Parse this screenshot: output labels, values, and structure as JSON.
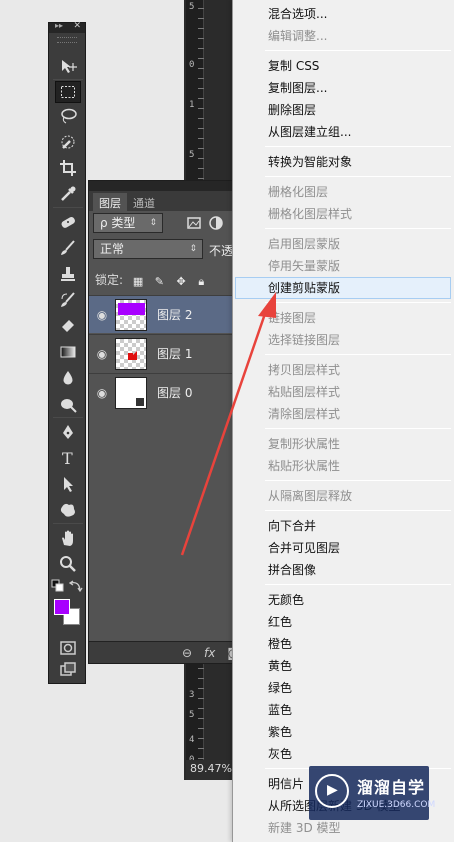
{
  "ruler": {
    "labels": [
      "5",
      "0",
      "1",
      "5",
      "5",
      "0",
      "3",
      "0",
      "3",
      "5",
      "4",
      "0"
    ]
  },
  "zoom": "89.47%",
  "tools": {
    "items": [
      {
        "name": "move-tool",
        "icon": "move-icon"
      },
      {
        "name": "marquee-tool",
        "icon": "marquee-icon"
      },
      {
        "name": "lasso-tool",
        "icon": "lasso-icon"
      },
      {
        "name": "quick-select-tool",
        "icon": "quick-select-icon"
      },
      {
        "name": "crop-tool",
        "icon": "crop-icon"
      },
      {
        "name": "eyedropper-tool",
        "icon": "eyedropper-icon"
      },
      {
        "name": "healing-tool",
        "icon": "bandage-icon"
      },
      {
        "name": "brush-tool",
        "icon": "brush-icon"
      },
      {
        "name": "stamp-tool",
        "icon": "stamp-icon"
      },
      {
        "name": "history-brush-tool",
        "icon": "history-brush-icon"
      },
      {
        "name": "eraser-tool",
        "icon": "eraser-icon"
      },
      {
        "name": "gradient-tool",
        "icon": "gradient-icon"
      },
      {
        "name": "blur-tool",
        "icon": "drop-icon"
      },
      {
        "name": "dodge-tool",
        "icon": "dodge-icon"
      },
      {
        "name": "pen-tool",
        "icon": "pen-icon"
      },
      {
        "name": "type-tool",
        "icon": "type-icon"
      },
      {
        "name": "path-select-tool",
        "icon": "arrow-icon"
      },
      {
        "name": "shape-tool",
        "icon": "shape-icon"
      },
      {
        "name": "hand-tool",
        "icon": "hand-icon"
      },
      {
        "name": "zoom-tool",
        "icon": "magnifier-icon"
      }
    ],
    "foreground_color": "#a800ff",
    "background_color": "#ffffff"
  },
  "layers_panel": {
    "tabs": [
      "图层",
      "通道"
    ],
    "filter_label": "ρ 类型",
    "blend_mode": "正常",
    "opacity_label": "不透",
    "lock_label": "锁定:",
    "layers": [
      {
        "name": "图层 2",
        "selected": true
      },
      {
        "name": "图层 1",
        "selected": false
      },
      {
        "name": "图层 0",
        "selected": false
      }
    ],
    "bottom_icons": [
      "link-icon",
      "fx-icon",
      "mask-icon"
    ],
    "fx_label": "fx"
  },
  "menu": {
    "items": [
      {
        "label": "混合选项...",
        "enabled": true
      },
      {
        "label": "编辑调整...",
        "enabled": false
      },
      {
        "sep": true
      },
      {
        "label": "复制 CSS",
        "enabled": true
      },
      {
        "label": "复制图层...",
        "enabled": true
      },
      {
        "label": "删除图层",
        "enabled": true
      },
      {
        "label": "从图层建立组...",
        "enabled": true
      },
      {
        "sep": true
      },
      {
        "label": "转换为智能对象",
        "enabled": true
      },
      {
        "sep": true
      },
      {
        "label": "栅格化图层",
        "enabled": false
      },
      {
        "label": "栅格化图层样式",
        "enabled": false
      },
      {
        "sep": true
      },
      {
        "label": "启用图层蒙版",
        "enabled": false
      },
      {
        "label": "停用矢量蒙版",
        "enabled": false
      },
      {
        "label": "创建剪贴蒙版",
        "enabled": true,
        "highlighted": true
      },
      {
        "sep": true
      },
      {
        "label": "链接图层",
        "enabled": false
      },
      {
        "label": "选择链接图层",
        "enabled": false
      },
      {
        "sep": true
      },
      {
        "label": "拷贝图层样式",
        "enabled": false
      },
      {
        "label": "粘贴图层样式",
        "enabled": false
      },
      {
        "label": "清除图层样式",
        "enabled": false
      },
      {
        "sep": true
      },
      {
        "label": "复制形状属性",
        "enabled": false
      },
      {
        "label": "粘贴形状属性",
        "enabled": false
      },
      {
        "sep": true
      },
      {
        "label": "从隔离图层释放",
        "enabled": false
      },
      {
        "sep": true
      },
      {
        "label": "向下合并",
        "enabled": true
      },
      {
        "label": "合并可见图层",
        "enabled": true
      },
      {
        "label": "拼合图像",
        "enabled": true
      },
      {
        "sep": true
      },
      {
        "label": "无颜色",
        "enabled": true
      },
      {
        "label": "红色",
        "enabled": true
      },
      {
        "label": "橙色",
        "enabled": true
      },
      {
        "label": "黄色",
        "enabled": true
      },
      {
        "label": "绿色",
        "enabled": true
      },
      {
        "label": "蓝色",
        "enabled": true
      },
      {
        "label": "紫色",
        "enabled": true
      },
      {
        "label": "灰色",
        "enabled": true
      },
      {
        "sep": true
      },
      {
        "label": "明信片",
        "enabled": true
      },
      {
        "label": "从所选图层新建 3D 模型",
        "enabled": true
      },
      {
        "label": "新建 3D 模型",
        "enabled": false
      }
    ]
  },
  "annotation": {
    "arrow_color": "#e8433c"
  },
  "watermark": {
    "title": "溜溜自学",
    "subtitle": "ZIXUE.3D66.COM"
  }
}
